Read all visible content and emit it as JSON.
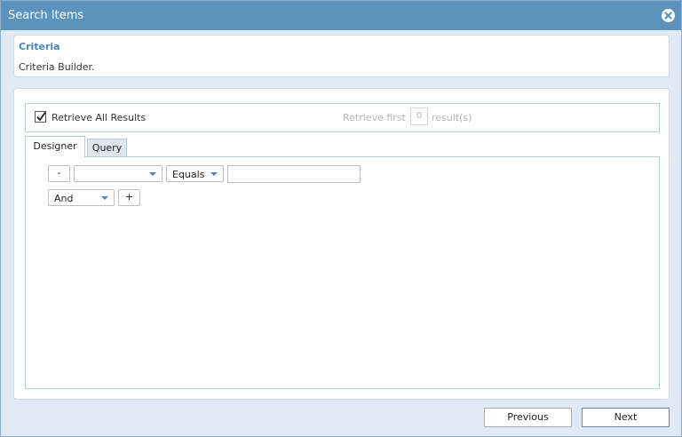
{
  "dialog": {
    "title": "Search Items",
    "close_icon": "close-icon"
  },
  "criteria": {
    "heading": "Criteria",
    "description": "Criteria Builder."
  },
  "options": {
    "retrieve_all_checked": true,
    "retrieve_all_label": "Retrieve All Results",
    "retrieve_first_label": "Retrieve first",
    "retrieve_count": "0",
    "results_label": "result(s)"
  },
  "tabs": [
    {
      "label": "Designer",
      "active": true
    },
    {
      "label": "Query",
      "active": false
    }
  ],
  "designer": {
    "remove_label": "-",
    "field_value": "",
    "operator_value": "Equals",
    "value_input": "",
    "logic_value": "And",
    "add_label": "+"
  },
  "footer": {
    "previous_label": "Previous",
    "next_label": "Next"
  },
  "colors": {
    "titlebar": "#5b93bd",
    "accent": "#4a86b4",
    "background": "#dfeaf4"
  }
}
